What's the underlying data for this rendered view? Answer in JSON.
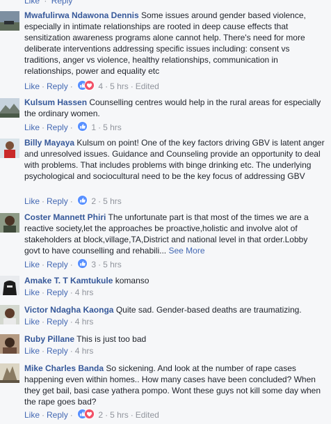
{
  "top": {
    "like": "Like",
    "sep": "·",
    "reply": "Reply"
  },
  "labels": {
    "like": "Like",
    "reply": "Reply",
    "sep": "·",
    "see_more": "See More"
  },
  "colors": {
    "name": "#365899",
    "link": "#4267b2",
    "meta": "#90949c",
    "like_blue": "#5890ff",
    "love_red": "#f25268",
    "bg": "#f6f7f9"
  },
  "comments": [
    {
      "author": "Mwafulirwa Ndawona Dennis",
      "text": "Some issues around gender based violence, especially in intimate relationships are rooted in deep cause effects that sensitization awareness programs alone cannot help. There's need for more deliberate interventions addressing specific issues including: consent vs traditions, anger vs violence, healthy relationships, communication in relationships, power and equality etc",
      "reactions": [
        "like-icon",
        "love-icon"
      ],
      "count": "4",
      "time": "5 hrs",
      "edited": "Edited"
    },
    {
      "author": "Kulsum Hassen",
      "text": "Counselling centres would help in the rural areas for especially the ordinary women.",
      "reactions": [
        "like-icon"
      ],
      "count": "1",
      "time": "5 hrs"
    },
    {
      "author": "Billy Mayaya",
      "text": "Kulsum on point! One of the key factors driving GBV is latent anger and unresolved issues. Guidance and Counseling provide an opportunity to deal with problems. That includes problems with binge drinking etc. The underlying psychological and sociocultural need to be the key focus of addressing GBV",
      "reactions": [
        "like-icon"
      ],
      "count": "2",
      "time": "5 hrs"
    },
    {
      "author": "Coster Mannett Phiri",
      "text": "The unfortunate part is that most of the times we are a reactive society,let the approaches be proactive,holistic and involve alot of stakeholders at block,village,TA,District and national level in that order.Lobby govt to have counselling and rehabili...",
      "reactions": [
        "like-icon"
      ],
      "count": "3",
      "time": "5 hrs"
    },
    {
      "author": "Amake T. T Kamtukule",
      "text": "komanso",
      "time": "4 hrs"
    },
    {
      "author": "Victor Ndagha Kaonga",
      "text": "Quite sad. Gender-based deaths are traumatizing.",
      "time": "4 hrs"
    },
    {
      "author": "Ruby Pillane",
      "text": "This is just too bad",
      "time": "4 hrs"
    },
    {
      "author": "Mike Charles Banda",
      "text": "So sickening. And look at the number of rape cases happening even within homes.. How many cases have been concluded? When they get bail, basi case yathera pompo. Wont these guys not kill some day when the rape goes bad?",
      "reactions": [
        "like-icon",
        "love-icon"
      ],
      "count": "2",
      "time": "5 hrs",
      "edited": "Edited"
    }
  ]
}
